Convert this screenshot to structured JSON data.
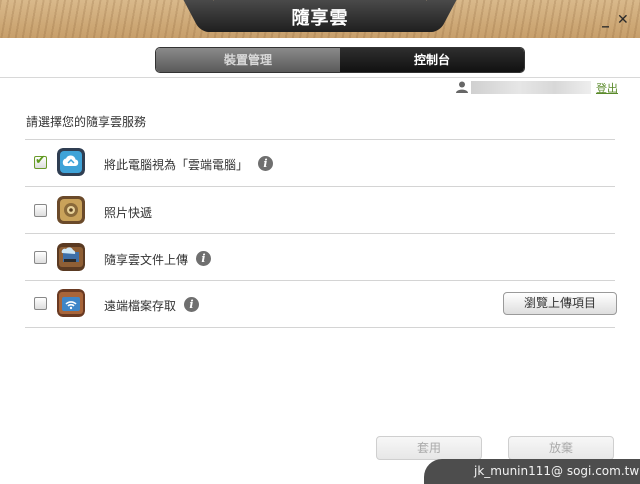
{
  "window": {
    "title": "隨享雲",
    "minimize_label": "_",
    "close_label": "✕"
  },
  "tabs": [
    {
      "label": "裝置管理",
      "active": false
    },
    {
      "label": "控制台",
      "active": true
    }
  ],
  "user": {
    "icon": "user-icon",
    "logout_label": "登出"
  },
  "prompt": "請選擇您的隨享雲服務",
  "services": [
    {
      "label": "將此電腦視為「雲端電腦」",
      "checked": true,
      "icon": "cloud-computer-icon",
      "has_info": true
    },
    {
      "label": "照片快遞",
      "checked": false,
      "icon": "photo-express-icon",
      "has_info": false
    },
    {
      "label": "隨享雲文件上傳",
      "checked": false,
      "icon": "document-upload-icon",
      "has_info": true
    },
    {
      "label": "遠端檔案存取",
      "checked": false,
      "icon": "remote-file-access-icon",
      "has_info": true
    }
  ],
  "browse_button": "瀏覽上傳項目",
  "footer": {
    "apply_label": "套用",
    "discard_label": "放棄"
  },
  "watermark": "jk_munin111@ sogi.com.tw",
  "colors": {
    "check_green": "#5e9a1e",
    "logout_green": "#5a8a2a",
    "tab_active": "#1a1a1a",
    "tab_inactive": "#6e6e6e"
  }
}
